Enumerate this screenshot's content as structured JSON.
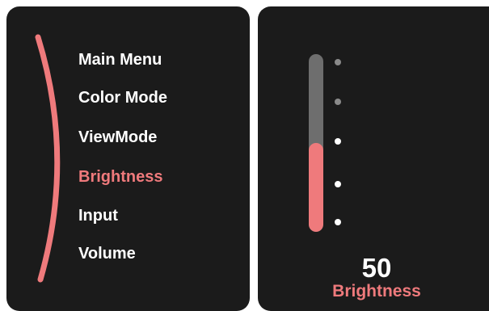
{
  "menu": {
    "items": [
      {
        "label": "Main Menu"
      },
      {
        "label": "Color Mode"
      },
      {
        "label": "ViewMode"
      },
      {
        "label": "Brightness"
      },
      {
        "label": "Input"
      },
      {
        "label": "Volume"
      }
    ],
    "active_item": "Brightness"
  },
  "brightness": {
    "value": "50",
    "label": "Brightness",
    "level_percent": 50
  },
  "colors": {
    "panel_background": "#1b1b1b",
    "accent": "#ef7a7c",
    "text": "#ffffff",
    "track": "#6e6e6e",
    "tick_dim": "#8a8a8a",
    "tick_lit": "#ffffff"
  }
}
